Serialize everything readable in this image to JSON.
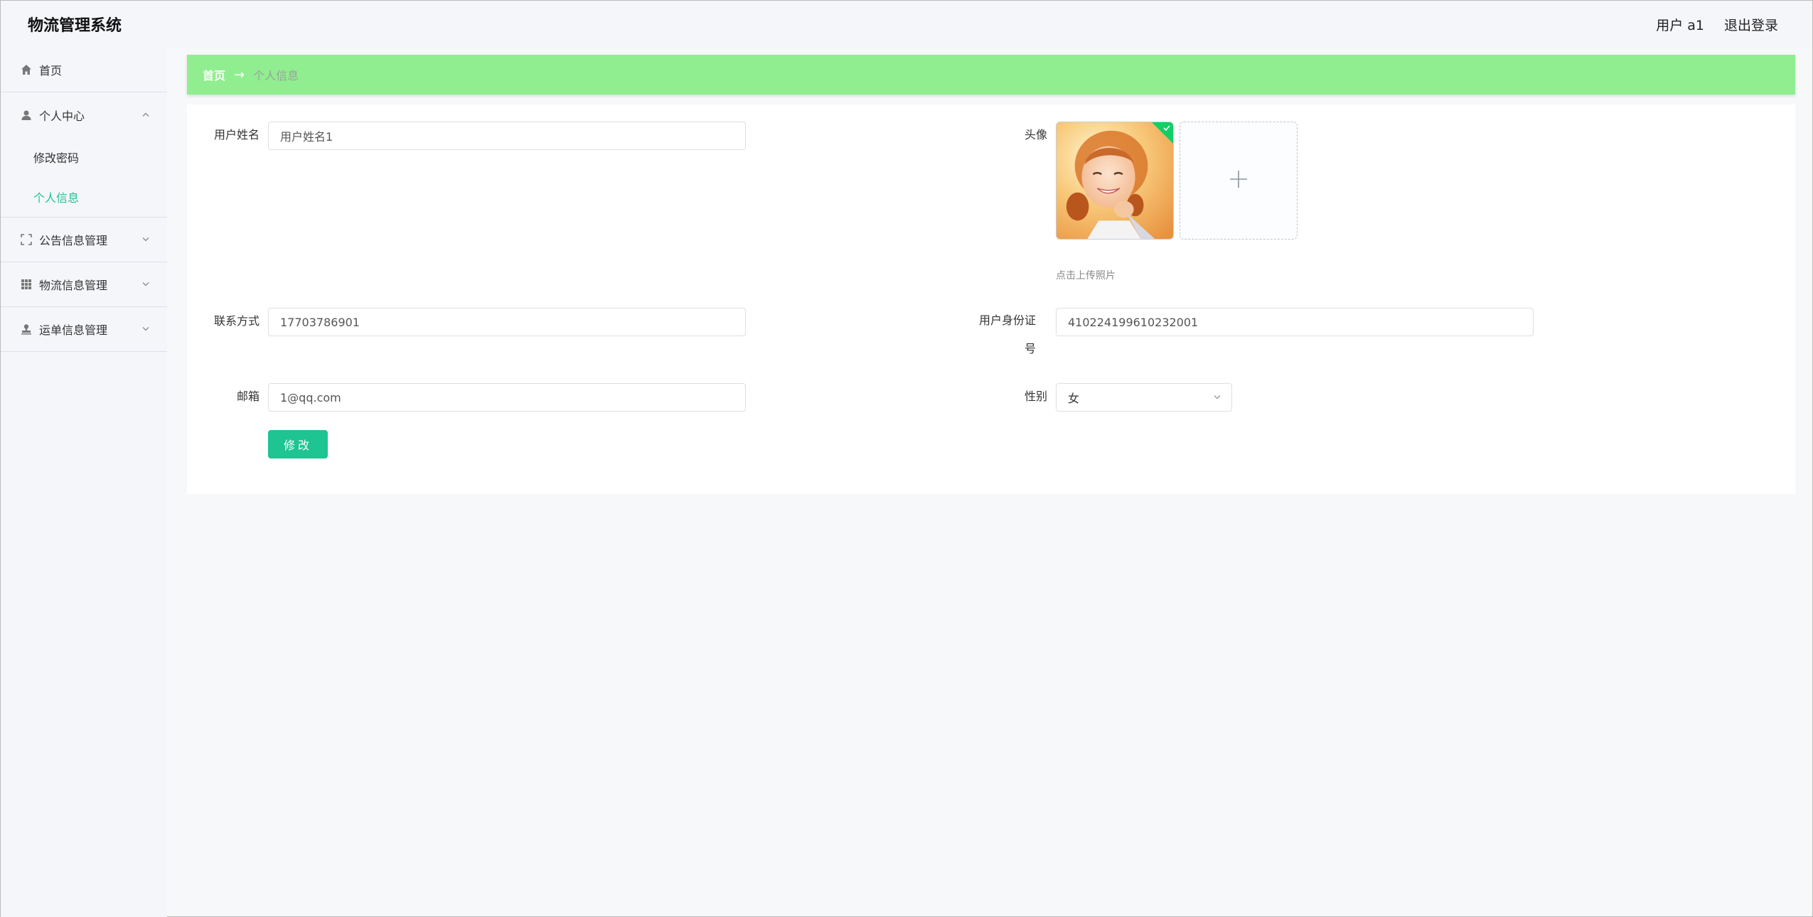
{
  "header": {
    "brand": "物流管理系统",
    "user_label": "用户 a1",
    "logout_label": "退出登录"
  },
  "sidebar": {
    "home": "首页",
    "personal_center": "个人中心",
    "change_password": "修改密码",
    "personal_info": "个人信息",
    "notice_mgmt": "公告信息管理",
    "logistics_mgmt": "物流信息管理",
    "waybill_mgmt": "运单信息管理"
  },
  "breadcrumb": {
    "home": "首页",
    "arrow": "→",
    "current": "个人信息"
  },
  "form": {
    "username_label": "用户姓名",
    "username_value": "用户姓名1",
    "avatar_label": "头像",
    "upload_hint": "点击上传照片",
    "contact_label": "联系方式",
    "contact_value": "17703786901",
    "idcard_label": "用户身份证号",
    "idcard_value": "410224199610232001",
    "email_label": "邮箱",
    "email_value": "1@qq.com",
    "gender_label": "性别",
    "gender_value": "女",
    "submit_label": "修改"
  },
  "colors": {
    "accent": "#1ec492",
    "breadcrumb_bg": "#90ee90"
  }
}
